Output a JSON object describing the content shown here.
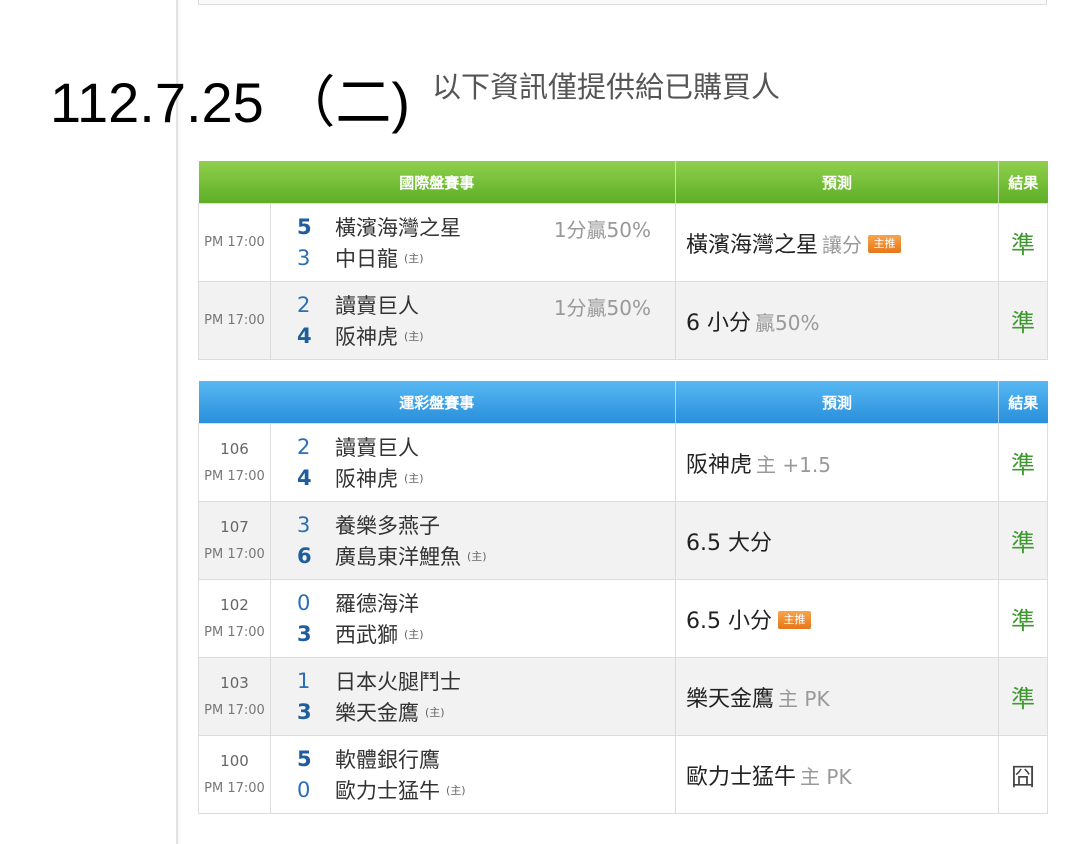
{
  "heading": {
    "date": "112.7.25 （二)",
    "notice": "以下資訊僅提供給已購買人"
  },
  "colors": {
    "green_header": "#6cbb30",
    "blue_header": "#3a9be2",
    "win_mark": "#3e9a2f",
    "score_blue": "#2a6fb6",
    "badge_orange": "#ee8a2d"
  },
  "international": {
    "headers": [
      "國際盤賽事",
      "預測",
      "結果"
    ],
    "rows": [
      {
        "time": "PM 17:00",
        "away": {
          "score": "5",
          "name": "橫濱海灣之星"
        },
        "home": {
          "score": "3",
          "name": "中日龍",
          "host": "(主)"
        },
        "handicap": "1分贏50%",
        "prediction": {
          "main": "橫濱海灣之星",
          "sub": "讓分",
          "badge": "主推"
        },
        "result": "準"
      },
      {
        "time": "PM 17:00",
        "away": {
          "score": "2",
          "name": "讀賣巨人"
        },
        "home": {
          "score": "4",
          "name": "阪神虎",
          "host": "(主)"
        },
        "handicap": "1分贏50%",
        "prediction": {
          "main": "6 小分",
          "sub": "贏50%"
        },
        "result": "準"
      }
    ]
  },
  "sports_lottery": {
    "headers": [
      "運彩盤賽事",
      "預測",
      "結果"
    ],
    "rows": [
      {
        "code": "106",
        "time": "PM 17:00",
        "away": {
          "score": "2",
          "name": "讀賣巨人"
        },
        "home": {
          "score": "4",
          "name": "阪神虎",
          "host": "(主)"
        },
        "prediction": {
          "main": "阪神虎",
          "sub": "主 +1.5"
        },
        "result": "準"
      },
      {
        "code": "107",
        "time": "PM 17:00",
        "away": {
          "score": "3",
          "name": "養樂多燕子"
        },
        "home": {
          "score": "6",
          "name": "廣島東洋鯉魚",
          "host": "(主)"
        },
        "prediction": {
          "main": "6.5 大分"
        },
        "result": "準"
      },
      {
        "code": "102",
        "time": "PM 17:00",
        "away": {
          "score": "0",
          "name": "羅德海洋"
        },
        "home": {
          "score": "3",
          "name": "西武獅",
          "host": "(主)"
        },
        "prediction": {
          "main": "6.5 小分",
          "badge": "主推"
        },
        "result": "準"
      },
      {
        "code": "103",
        "time": "PM 17:00",
        "away": {
          "score": "1",
          "name": "日本火腿鬥士"
        },
        "home": {
          "score": "3",
          "name": "樂天金鷹",
          "host": "(主)"
        },
        "prediction": {
          "main": "樂天金鷹",
          "sub": "主 PK"
        },
        "result": "準"
      },
      {
        "code": "100",
        "time": "PM 17:00",
        "away": {
          "score": "5",
          "name": "軟體銀行鷹"
        },
        "home": {
          "score": "0",
          "name": "歐力士猛牛",
          "host": "(主)"
        },
        "prediction": {
          "main": "歐力士猛牛",
          "sub": "主 PK"
        },
        "result": "囧"
      }
    ]
  }
}
